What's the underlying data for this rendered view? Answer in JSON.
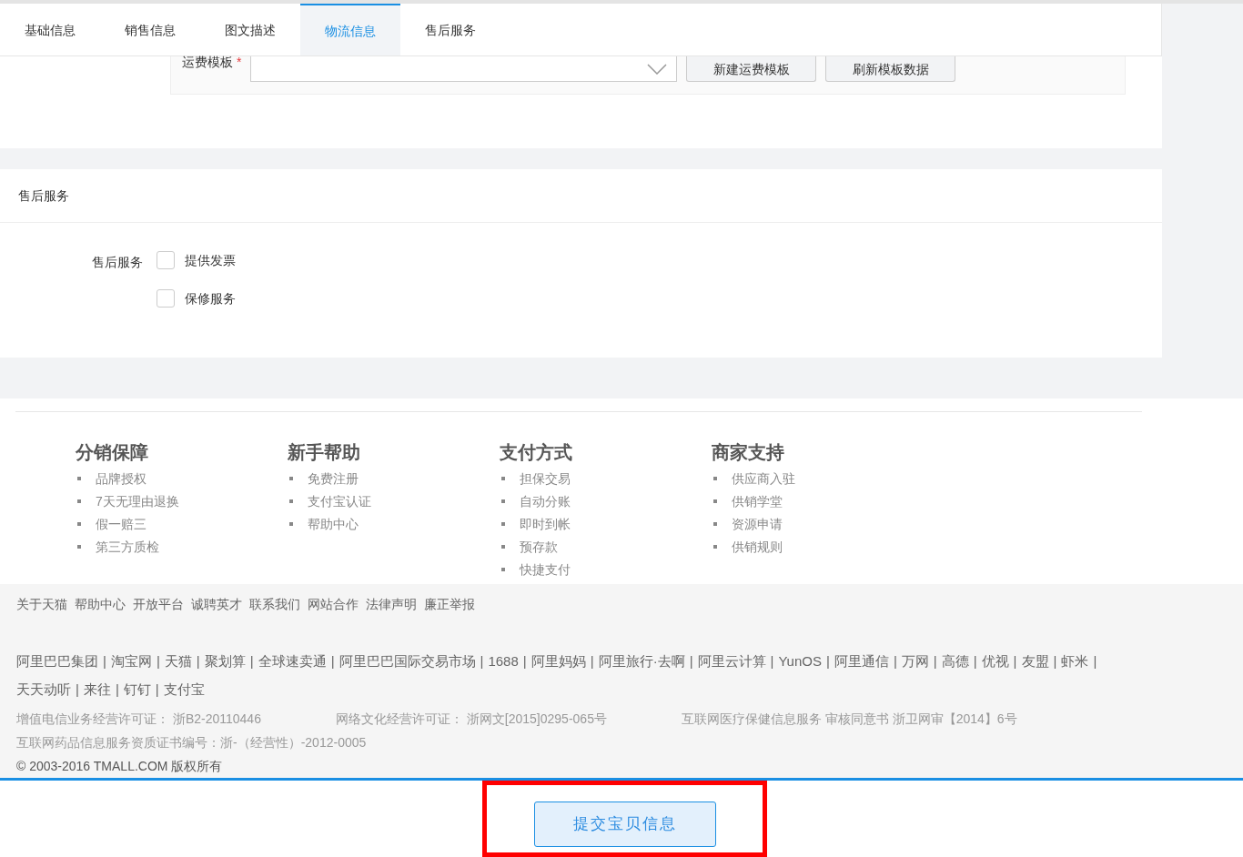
{
  "tabs": [
    {
      "label": "基础信息",
      "selected": false
    },
    {
      "label": "销售信息",
      "selected": false
    },
    {
      "label": "图文描述",
      "selected": false
    },
    {
      "label": "物流信息",
      "selected": true
    },
    {
      "label": "售后服务",
      "selected": false
    }
  ],
  "freight": {
    "label": "运费模板",
    "required_mark": "*",
    "buttons": [
      "新建运费模板",
      "刷新模板数据"
    ]
  },
  "after_sales": {
    "title": "售后服务",
    "label": "售后服务",
    "options": [
      {
        "label": "提供发票",
        "checked": false
      },
      {
        "label": "保修服务",
        "checked": false
      }
    ]
  },
  "footer": {
    "columns": [
      {
        "title": "分销保障",
        "items": [
          "品牌授权",
          "7天无理由退换",
          "假一赔三",
          "第三方质检"
        ]
      },
      {
        "title": "新手帮助",
        "items": [
          "免费注册",
          "支付宝认证",
          "帮助中心"
        ]
      },
      {
        "title": "支付方式",
        "items": [
          "担保交易",
          "自动分账",
          "即时到帐",
          "预存款",
          "快捷支付"
        ]
      },
      {
        "title": "商家支持",
        "items": [
          "供应商入驻",
          "供销学堂",
          "资源申请",
          "供销规则"
        ]
      }
    ],
    "links": [
      "关于天猫",
      "帮助中心",
      "开放平台",
      "诚聘英才",
      "联系我们",
      "网站合作",
      "法律声明",
      "廉正举报"
    ],
    "separator": "|",
    "partners": [
      "阿里巴巴集团",
      "淘宝网",
      "天猫",
      "聚划算",
      "全球速卖通",
      "阿里巴巴国际交易市场",
      "1688",
      "阿里妈妈",
      "阿里旅行·去啊",
      "阿里云计算",
      "YunOS",
      "阿里通信",
      "万网",
      "高德",
      "优视",
      "友盟",
      "虾米",
      "天天动听",
      "来往",
      "钉钉",
      "支付宝"
    ],
    "licenses": [
      "增值电信业务经营许可证： 浙B2-20110446",
      "网络文化经营许可证： 浙网文[2015]0295-065号",
      "互联网医疗保健信息服务 审核同意书 浙卫网审【2014】6号"
    ],
    "license_2": "互联网药品信息服务资质证书编号：浙-（经营性）-2012-0005",
    "copyright": "© 2003-2016 TMALL.COM 版权所有"
  },
  "submit_button": "提交宝贝信息"
}
